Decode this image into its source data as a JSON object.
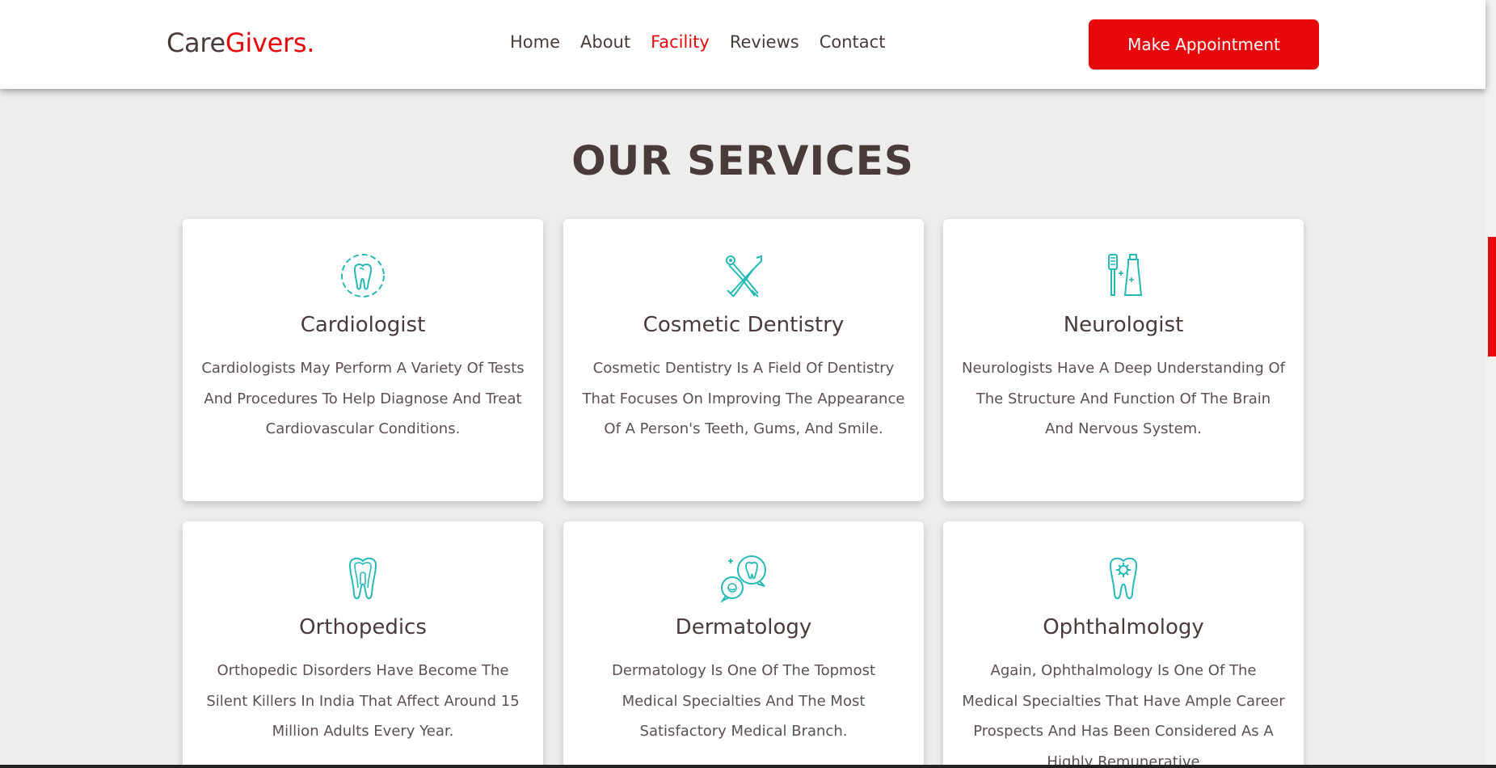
{
  "header": {
    "logo_main": "Care",
    "logo_accent": "Givers.",
    "nav": [
      "Home",
      "About",
      "Facility",
      "Reviews",
      "Contact"
    ],
    "active_nav": "Facility",
    "cta_label": "Make Appointment"
  },
  "section": {
    "title": "OUR SERVICES"
  },
  "services": [
    {
      "title": "Cardiologist",
      "desc": "Cardiologists May Perform A Variety Of Tests And Procedures To Help Diagnose And Treat Cardiovascular Conditions.",
      "icon": "tooth-dashed-icon"
    },
    {
      "title": "Cosmetic Dentistry",
      "desc": "Cosmetic Dentistry Is A Field Of Dentistry That Focuses On Improving The Appearance Of A Person's Teeth, Gums, And Smile.",
      "icon": "dental-tools-icon"
    },
    {
      "title": "Neurologist",
      "desc": "Neurologists Have A Deep Understanding Of The Structure And Function Of The Brain And Nervous System.",
      "icon": "toothbrush-toothpaste-icon"
    },
    {
      "title": "Orthopedics",
      "desc": "Orthopedic Disorders Have Become The Silent Killers In India That Affect Around 15 Million Adults Every Year.",
      "icon": "tooth-root-icon"
    },
    {
      "title": "Dermatology",
      "desc": "Dermatology Is One Of The Topmost Medical Specialties And The Most Satisfactory Medical Branch.",
      "icon": "tooth-chat-icon"
    },
    {
      "title": "Ophthalmology",
      "desc": "Again, Ophthalmology Is One Of The Medical Specialties That Have Ample Career Prospects And Has Been Considered As A Highly Remunerative",
      "icon": "tooth-gear-icon"
    }
  ],
  "colors": {
    "accent": "#e8080c",
    "icon": "#26b9b6",
    "text": "#4a3b3b",
    "background": "#ededed"
  }
}
